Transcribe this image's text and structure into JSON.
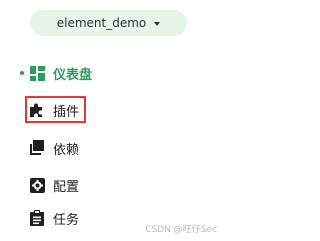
{
  "project_selector": {
    "value": "element_demo"
  },
  "menu": {
    "items": [
      {
        "label": "仪表盘",
        "icon": "dashboard-icon",
        "active": true
      },
      {
        "label": "插件",
        "icon": "puzzle-icon",
        "active": false,
        "highlighted": true
      },
      {
        "label": "依赖",
        "icon": "copy-icon",
        "active": false
      },
      {
        "label": "配置",
        "icon": "settings-icon",
        "active": false
      },
      {
        "label": "任务",
        "icon": "task-list-icon",
        "active": false
      }
    ]
  },
  "colors": {
    "active": "#2e9d5b",
    "selector_bg": "#e6f4ea",
    "highlight_border": "#e53935",
    "icon": "#1f1f1f"
  },
  "watermark": "CSDN @旺仔Sec"
}
